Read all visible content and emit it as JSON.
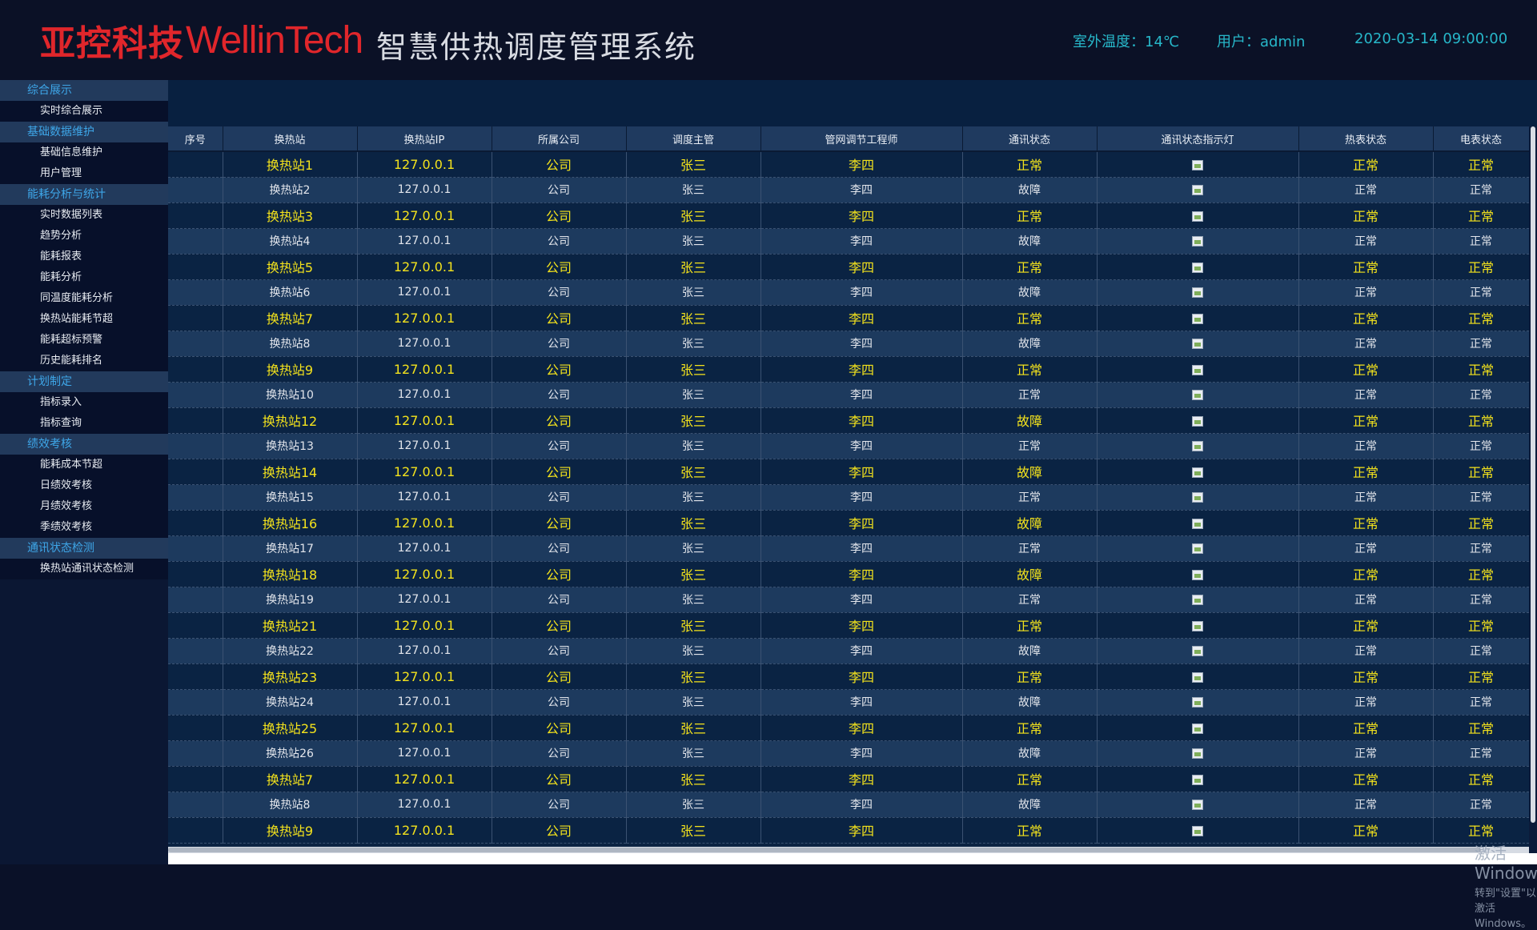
{
  "header": {
    "logo_cn": "亚控科技",
    "logo_en": "WellinTech",
    "system_title": "智慧供热调度管理系统",
    "outdoor_temp": "室外温度：14℃",
    "user": "用户：admin",
    "datetime": "2020-03-14 09:00:00"
  },
  "sidebar": {
    "groups": [
      {
        "label": "综合展示",
        "items": [
          "实时综合展示"
        ]
      },
      {
        "label": "基础数据维护",
        "items": [
          "基础信息维护",
          "用户管理"
        ]
      },
      {
        "label": "能耗分析与统计",
        "items": [
          "实时数据列表",
          "趋势分析",
          "能耗报表",
          "能耗分析",
          "同温度能耗分析",
          "换热站能耗节超",
          "能耗超标预警",
          "历史能耗排名"
        ]
      },
      {
        "label": "计划制定",
        "items": [
          "指标录入",
          "指标查询"
        ]
      },
      {
        "label": "绩效考核",
        "items": [
          "能耗成本节超",
          "日绩效考核",
          "月绩效考核",
          "季绩效考核"
        ]
      },
      {
        "label": "通讯状态检测",
        "items": [
          "换热站通讯状态检测"
        ]
      }
    ]
  },
  "table": {
    "columns": [
      "序号",
      "换热站",
      "换热站IP",
      "所属公司",
      "调度主管",
      "管网调节工程师",
      "通讯状态",
      "通讯状态指示灯",
      "热表状态",
      "电表状态"
    ],
    "rows": [
      [
        "",
        "换热站1",
        "127.0.0.1",
        "公司",
        "张三",
        "李四",
        "正常",
        "",
        "正常",
        "正常"
      ],
      [
        "",
        "换热站2",
        "127.0.0.1",
        "公司",
        "张三",
        "李四",
        "故障",
        "",
        "正常",
        "正常"
      ],
      [
        "",
        "换热站3",
        "127.0.0.1",
        "公司",
        "张三",
        "李四",
        "正常",
        "",
        "正常",
        "正常"
      ],
      [
        "",
        "换热站4",
        "127.0.0.1",
        "公司",
        "张三",
        "李四",
        "故障",
        "",
        "正常",
        "正常"
      ],
      [
        "",
        "换热站5",
        "127.0.0.1",
        "公司",
        "张三",
        "李四",
        "正常",
        "",
        "正常",
        "正常"
      ],
      [
        "",
        "换热站6",
        "127.0.0.1",
        "公司",
        "张三",
        "李四",
        "故障",
        "",
        "正常",
        "正常"
      ],
      [
        "",
        "换热站7",
        "127.0.0.1",
        "公司",
        "张三",
        "李四",
        "正常",
        "",
        "正常",
        "正常"
      ],
      [
        "",
        "换热站8",
        "127.0.0.1",
        "公司",
        "张三",
        "李四",
        "故障",
        "",
        "正常",
        "正常"
      ],
      [
        "",
        "换热站9",
        "127.0.0.1",
        "公司",
        "张三",
        "李四",
        "正常",
        "",
        "正常",
        "正常"
      ],
      [
        "",
        "换热站10",
        "127.0.0.1",
        "公司",
        "张三",
        "李四",
        "正常",
        "",
        "正常",
        "正常"
      ],
      [
        "",
        "换热站12",
        "127.0.0.1",
        "公司",
        "张三",
        "李四",
        "故障",
        "",
        "正常",
        "正常"
      ],
      [
        "",
        "换热站13",
        "127.0.0.1",
        "公司",
        "张三",
        "李四",
        "正常",
        "",
        "正常",
        "正常"
      ],
      [
        "",
        "换热站14",
        "127.0.0.1",
        "公司",
        "张三",
        "李四",
        "故障",
        "",
        "正常",
        "正常"
      ],
      [
        "",
        "换热站15",
        "127.0.0.1",
        "公司",
        "张三",
        "李四",
        "正常",
        "",
        "正常",
        "正常"
      ],
      [
        "",
        "换热站16",
        "127.0.0.1",
        "公司",
        "张三",
        "李四",
        "故障",
        "",
        "正常",
        "正常"
      ],
      [
        "",
        "换热站17",
        "127.0.0.1",
        "公司",
        "张三",
        "李四",
        "正常",
        "",
        "正常",
        "正常"
      ],
      [
        "",
        "换热站18",
        "127.0.0.1",
        "公司",
        "张三",
        "李四",
        "故障",
        "",
        "正常",
        "正常"
      ],
      [
        "",
        "换热站19",
        "127.0.0.1",
        "公司",
        "张三",
        "李四",
        "正常",
        "",
        "正常",
        "正常"
      ],
      [
        "",
        "换热站21",
        "127.0.0.1",
        "公司",
        "张三",
        "李四",
        "正常",
        "",
        "正常",
        "正常"
      ],
      [
        "",
        "换热站22",
        "127.0.0.1",
        "公司",
        "张三",
        "李四",
        "故障",
        "",
        "正常",
        "正常"
      ],
      [
        "",
        "换热站23",
        "127.0.0.1",
        "公司",
        "张三",
        "李四",
        "正常",
        "",
        "正常",
        "正常"
      ],
      [
        "",
        "换热站24",
        "127.0.0.1",
        "公司",
        "张三",
        "李四",
        "故障",
        "",
        "正常",
        "正常"
      ],
      [
        "",
        "换热站25",
        "127.0.0.1",
        "公司",
        "张三",
        "李四",
        "正常",
        "",
        "正常",
        "正常"
      ],
      [
        "",
        "换热站26",
        "127.0.0.1",
        "公司",
        "张三",
        "李四",
        "故障",
        "",
        "正常",
        "正常"
      ],
      [
        "",
        "换热站7",
        "127.0.0.1",
        "公司",
        "张三",
        "李四",
        "正常",
        "",
        "正常",
        "正常"
      ],
      [
        "",
        "换热站8",
        "127.0.0.1",
        "公司",
        "张三",
        "李四",
        "故障",
        "",
        "正常",
        "正常"
      ],
      [
        "",
        "换热站9",
        "127.0.0.1",
        "公司",
        "张三",
        "李四",
        "正常",
        "",
        "正常",
        "正常"
      ]
    ]
  },
  "watermark": {
    "line1": "激活 Windows",
    "line2": "转到\"设置\"以激活 Windows。"
  },
  "colors": {
    "logo": "#e0262b",
    "header_info": "#27b7c9",
    "highlight_row_text": "#f3e21c",
    "menu_group_text": "#3ea6e8"
  },
  "icons": {
    "status_lamp": "broken-image-icon"
  }
}
